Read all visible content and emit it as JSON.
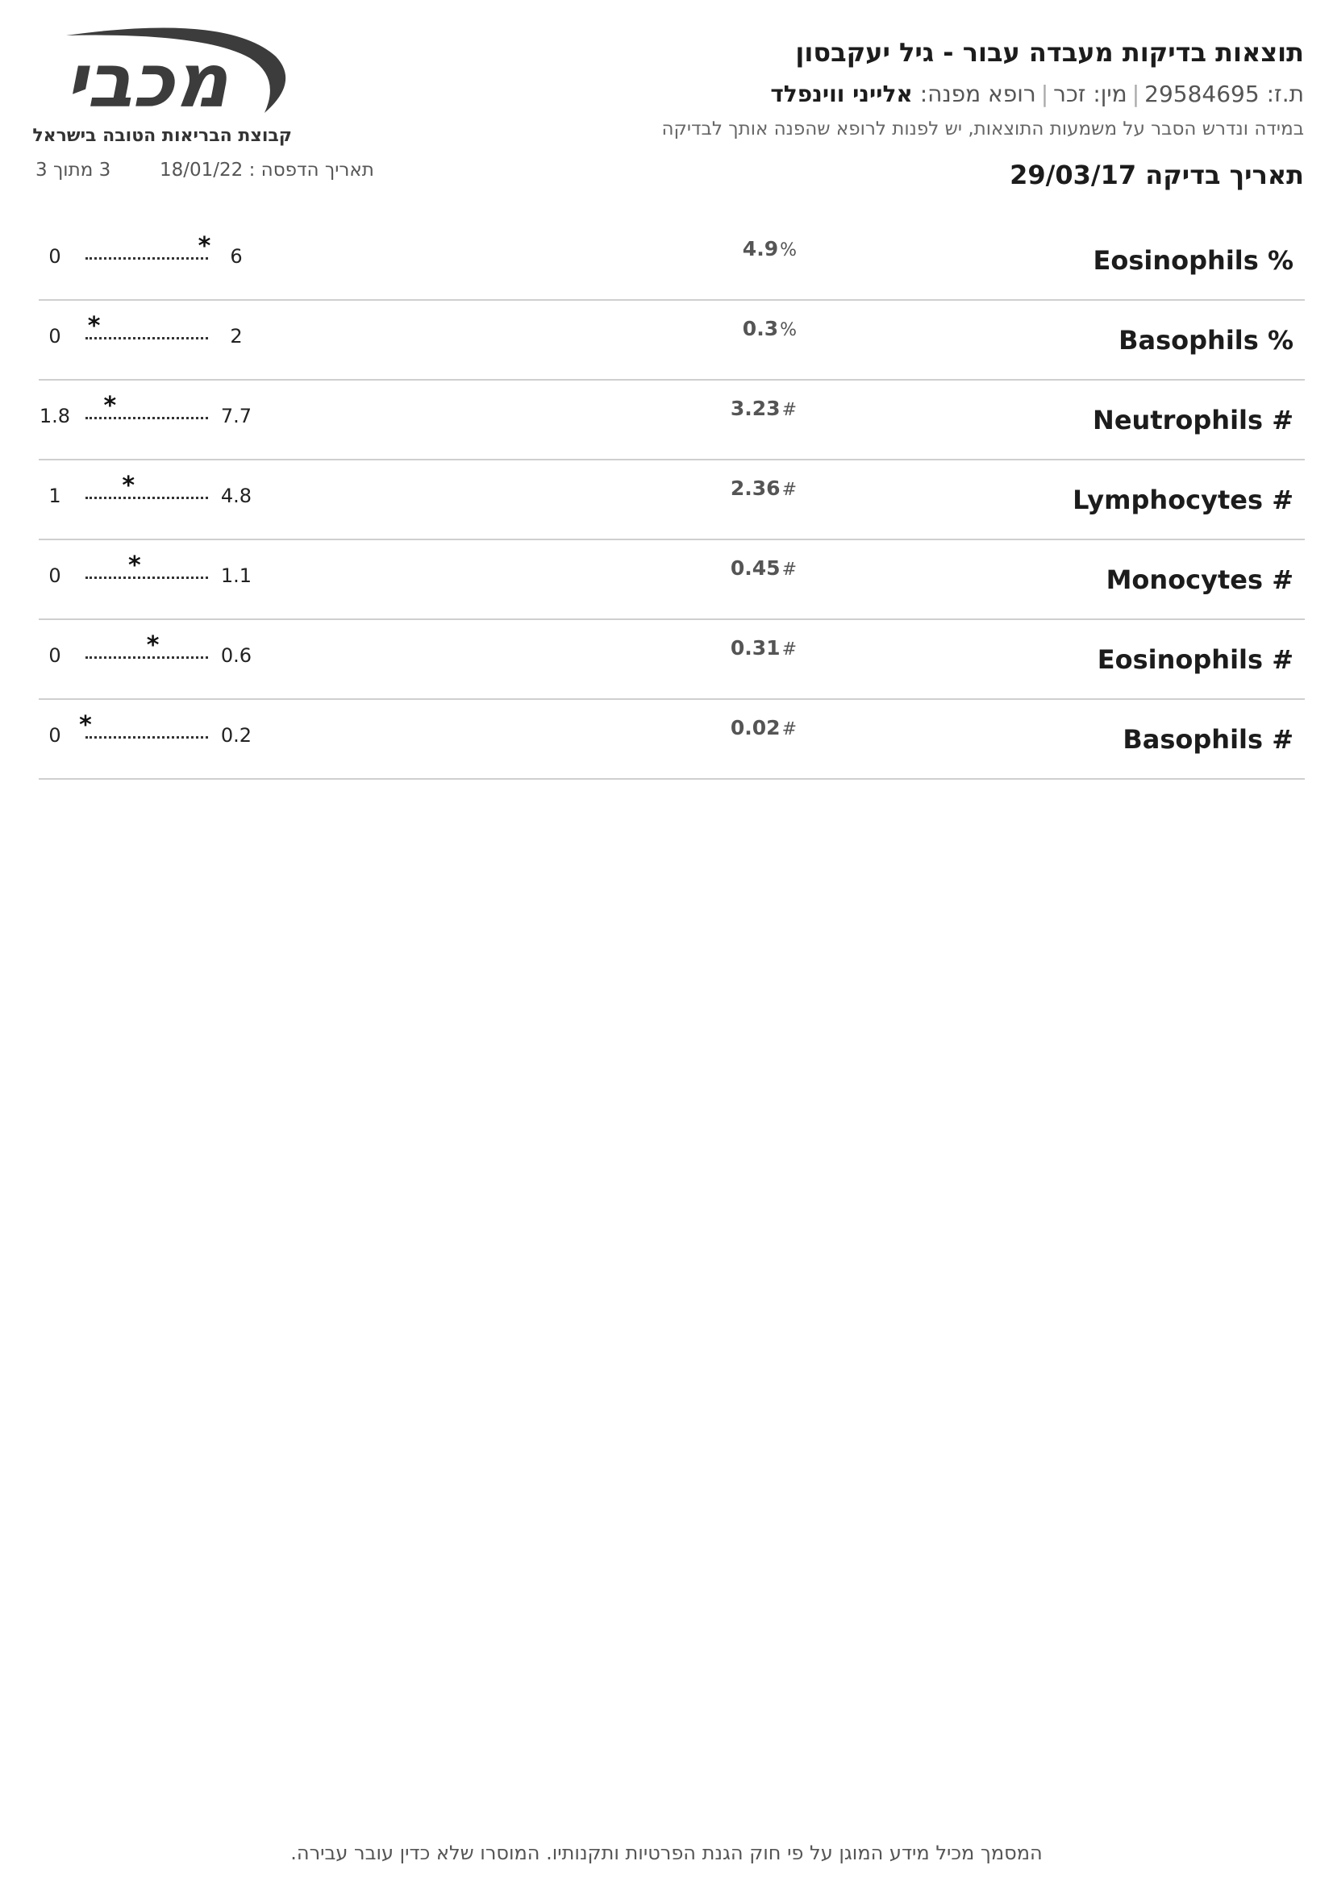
{
  "header": {
    "title": "תוצאות בדיקות מעבדה עבור - גיל יעקבסון",
    "id_label": "ת.ז:",
    "id_value": "29584695",
    "gender_label": "מין:",
    "gender_value": "זכר",
    "doctor_label": "רופא מפנה:",
    "doctor_name": "אלייני ווינפלד",
    "notice": "במידה ונדרש הסבר על משמעות התוצאות, יש לפנות לרופא שהפנה אותך לבדיקה",
    "test_date_label": "תאריך בדיקה",
    "test_date": "29/03/17"
  },
  "logo": {
    "text": "מכבי",
    "subtitle": "קבוצת הבריאות הטובה בישראל",
    "color": "#3c3c3c"
  },
  "print_info": {
    "print_date_label": "תאריך הדפסה :",
    "print_date": "18/01/22",
    "page": "3 מתוך 3"
  },
  "results": [
    {
      "name": "Eosinophils %",
      "value": "4.9",
      "unit": "%",
      "min": "0",
      "max": "6",
      "position": 0.97
    },
    {
      "name": "Basophils %",
      "value": "0.3",
      "unit": "%",
      "min": "0",
      "max": "2",
      "position": 0.07
    },
    {
      "name": "Neutrophils #",
      "value": "3.23",
      "unit": "#",
      "min": "1.8",
      "max": "7.7",
      "position": 0.2
    },
    {
      "name": "Lymphocytes #",
      "value": "2.36",
      "unit": "#",
      "min": "1",
      "max": "4.8",
      "position": 0.35
    },
    {
      "name": "Monocytes #",
      "value": "0.45",
      "unit": "#",
      "min": "0",
      "max": "1.1",
      "position": 0.4
    },
    {
      "name": "Eosinophils #",
      "value": "0.31",
      "unit": "#",
      "min": "0",
      "max": "0.6",
      "position": 0.55
    },
    {
      "name": "Basophils #",
      "value": "0.02",
      "unit": "#",
      "min": "0",
      "max": "0.2",
      "position": 0.0
    }
  ],
  "footer": {
    "text": "המסמך מכיל מידע המוגן על פי חוק הגנת הפרטיות ותקנותיו. המוסרו שלא כדין עובר עבירה."
  }
}
